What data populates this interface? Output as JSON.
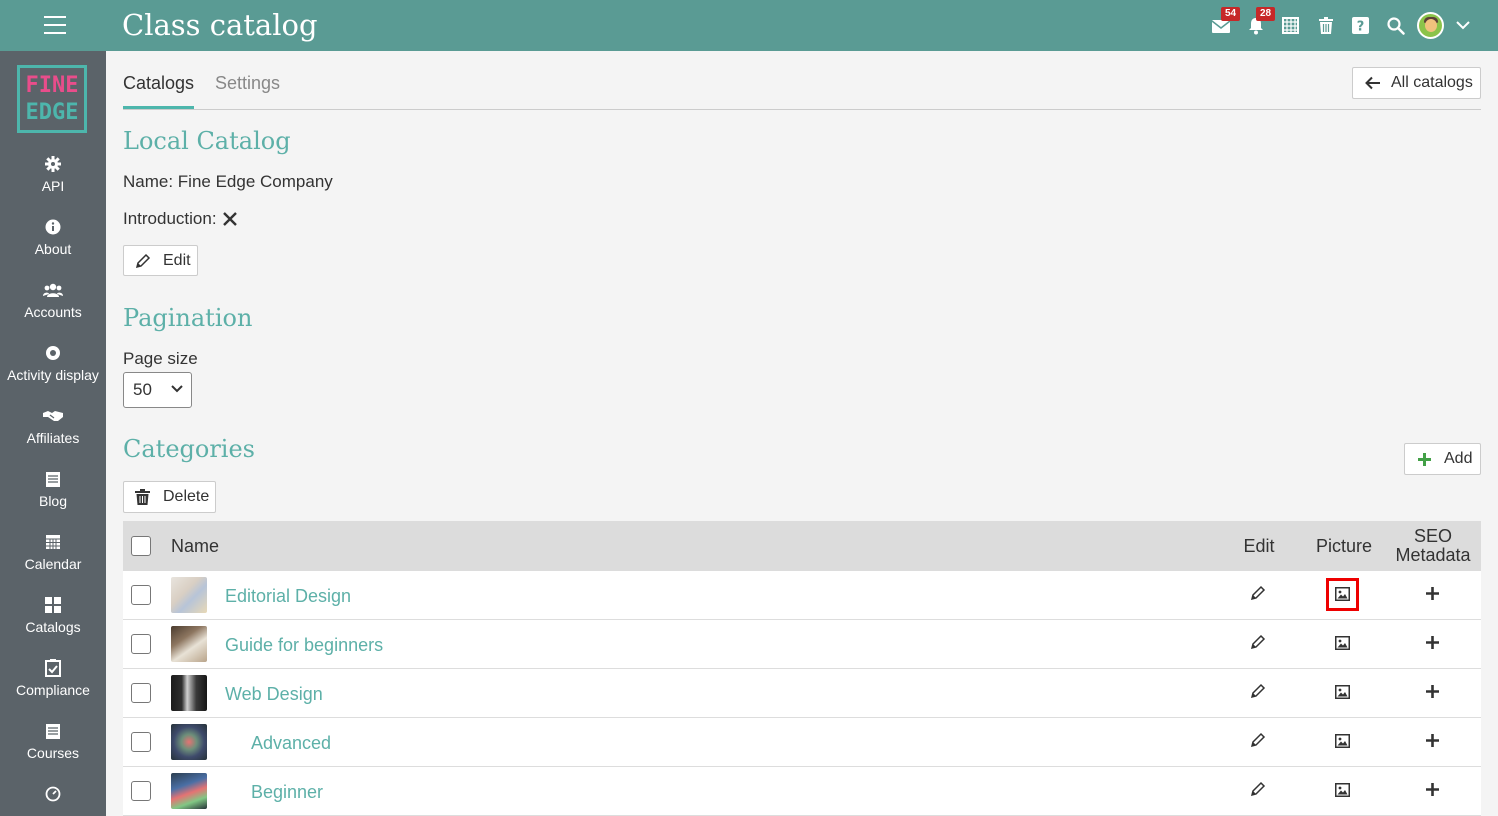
{
  "header": {
    "title": "Class catalog",
    "mail_count": "54",
    "notification_count": "28",
    "icons": [
      "mail-icon",
      "bell-icon",
      "calendar-icon",
      "trash-icon",
      "help-icon",
      "search-icon",
      "avatar",
      "chevron-down-icon"
    ]
  },
  "sidebar": {
    "logo_line1": "FINE",
    "logo_line2": "EDGE",
    "items": [
      {
        "label": "API",
        "icon": "gear-icon"
      },
      {
        "label": "About",
        "icon": "info-icon"
      },
      {
        "label": "Accounts",
        "icon": "users-icon"
      },
      {
        "label": "Activity display",
        "icon": "dot-circle-icon"
      },
      {
        "label": "Affiliates",
        "icon": "handshake-icon"
      },
      {
        "label": "Blog",
        "icon": "blog-icon"
      },
      {
        "label": "Calendar",
        "icon": "calendar-icon"
      },
      {
        "label": "Catalogs",
        "icon": "grid-icon"
      },
      {
        "label": "Compliance",
        "icon": "check-square-icon"
      },
      {
        "label": "Courses",
        "icon": "courses-icon"
      }
    ]
  },
  "tabs": {
    "catalogs": "Catalogs",
    "settings": "Settings"
  },
  "all_catalogs_label": "All catalogs",
  "local_catalog": {
    "heading": "Local Catalog",
    "name_line": "Name: Fine Edge Company",
    "intro_label": "Introduction:",
    "edit_label": "Edit"
  },
  "pagination": {
    "heading": "Pagination",
    "page_size_label": "Page size",
    "page_size_value": "50"
  },
  "categories": {
    "heading": "Categories",
    "add_label": "Add",
    "delete_label": "Delete",
    "columns": {
      "name": "Name",
      "edit": "Edit",
      "picture": "Picture",
      "seo_line1": "SEO",
      "seo_line2": "Metadata"
    },
    "rows": [
      {
        "name": "Editorial Design",
        "level": 0
      },
      {
        "name": "Guide for beginners",
        "level": 0
      },
      {
        "name": "Web Design",
        "level": 0
      },
      {
        "name": "Advanced",
        "level": 1
      },
      {
        "name": "Beginner",
        "level": 1
      }
    ]
  },
  "colors": {
    "header": "#5a9b94",
    "sidebar": "#5b6369",
    "accent": "#5db0a8",
    "highlight": "#e00000"
  }
}
